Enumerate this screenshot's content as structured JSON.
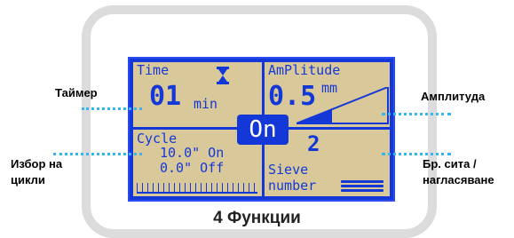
{
  "lcd": {
    "time_label": "Time",
    "time_value": "01",
    "time_unit": "min",
    "amplitude_label": "AmPlitude",
    "amplitude_value": "0.5",
    "amplitude_unit": "mm",
    "cycle_label": "Cycle",
    "cycle_on": "10.0\" On",
    "cycle_off": "0.0\" Off",
    "on_indicator": "On",
    "sieve_count": "2",
    "sieve_label": "Sieve",
    "sieve_sub": "number"
  },
  "labels": {
    "timer": "Таймер",
    "amplitude": "Амплитуда",
    "cycle_select_line1": "Избор на",
    "cycle_select_line2": "цикли",
    "sieve_count_line1": "Бр. сита /",
    "sieve_count_line2": "нагласяване"
  },
  "caption": "4 Функции",
  "colors": {
    "lcd_background": "#d9c99a",
    "lcd_blue": "#1438d8",
    "dotted_line": "#36b5ef"
  },
  "icons": [
    "hourglass-icon",
    "amplitude-ramp-icon",
    "sieve-stack-icon"
  ]
}
